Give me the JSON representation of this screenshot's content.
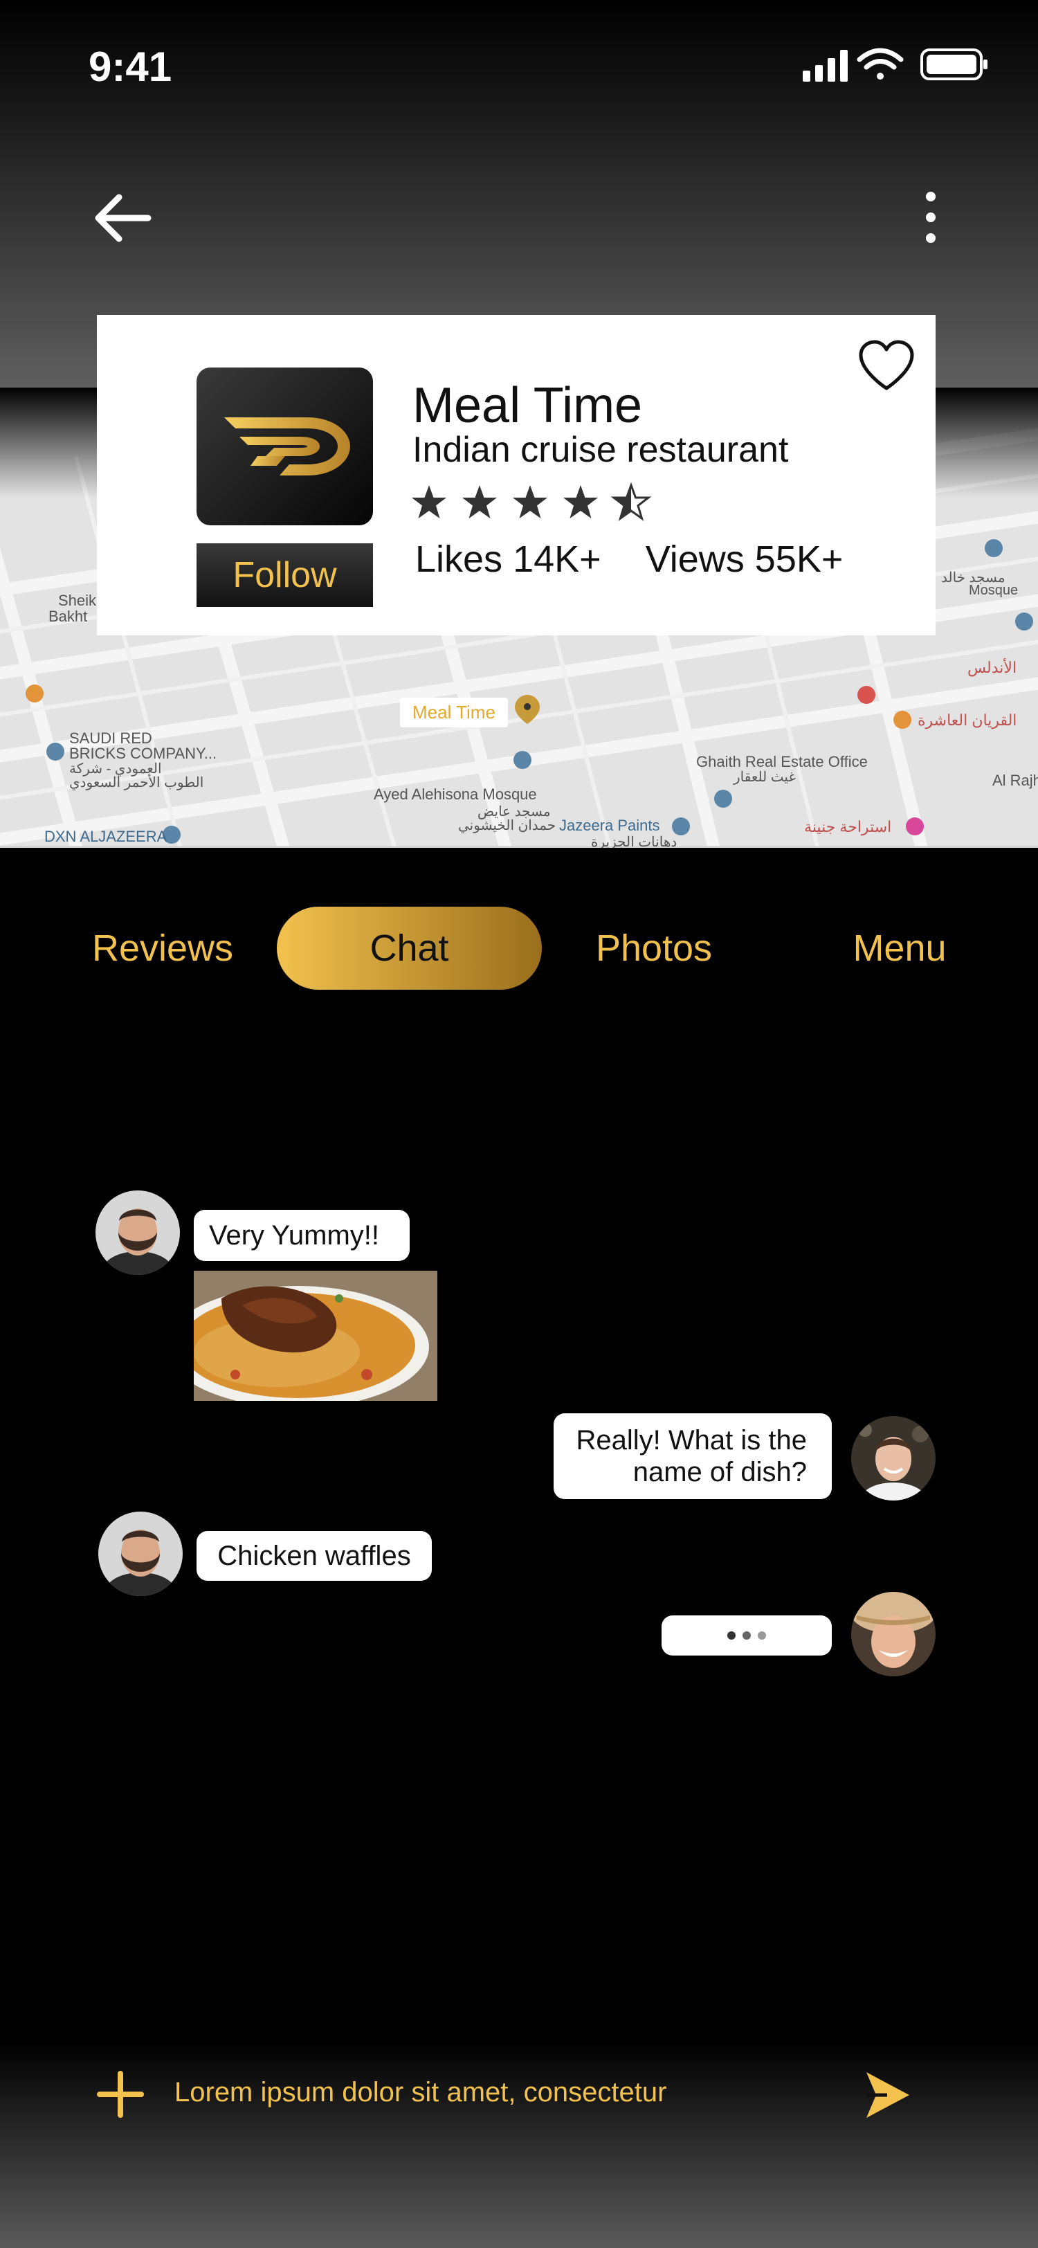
{
  "status": {
    "time": "9:41"
  },
  "map": {
    "labels": {
      "sheik": "Sheik",
      "bakht": "Bakht",
      "saudi_red_1": "SAUDI RED",
      "saudi_red_2": "BRICKS COMPANY...",
      "saudi_red_ar": "العمودي - شركة",
      "saudi_red_ar2": "الطوب الأحمر السعودي",
      "dxn": "DXN ALJAZEERA",
      "ayed": "Ayed Alehisona Mosque",
      "ayed_ar": "مسجد عايض",
      "ayed_ar2": "حمدان الخيشوني",
      "jazeera": "Jazeera Paints",
      "jazeera_ar": "دهانات الجزيرة",
      "ghaith": "Ghaith Real Estate Office",
      "ghaith_ar": "غيث للعقار",
      "mosque": "Mosque",
      "mosque_ar": "مسجد خالد",
      "al_rajh": "Al Rajh",
      "andalus_ar": "الأندلس",
      "qurayan_ar": "القريان العاشرة",
      "istiraha_ar": "استراحة جنينة"
    },
    "pin_label": "Meal Time"
  },
  "restaurant": {
    "name": "Meal Time",
    "subtitle": "Indian cruise restaurant",
    "rating": 4.5,
    "follow_label": "Follow",
    "likes": "Likes 14K+",
    "views": "Views 55K+"
  },
  "tabs": [
    {
      "label": "Reviews",
      "active": false
    },
    {
      "label": "Chat",
      "active": true
    },
    {
      "label": "Photos",
      "active": false
    },
    {
      "label": "Menu",
      "active": false
    }
  ],
  "chat": {
    "messages": [
      {
        "side": "left",
        "text": "Very Yummy!!"
      },
      {
        "side": "right",
        "line1": "Really! What is the",
        "line2": "name of dish?"
      },
      {
        "side": "left",
        "text": "Chicken waffles"
      }
    ]
  },
  "composer": {
    "text": "Lorem ipsum dolor sit amet, consectetur"
  },
  "colors": {
    "accent": "#f2c14e",
    "accent_dark": "#9a6f1c",
    "background": "#000000"
  },
  "icons": {
    "back": "arrow-left-icon",
    "more": "more-vertical-icon",
    "heart": "heart-icon",
    "plus": "plus-icon",
    "send": "send-icon"
  }
}
